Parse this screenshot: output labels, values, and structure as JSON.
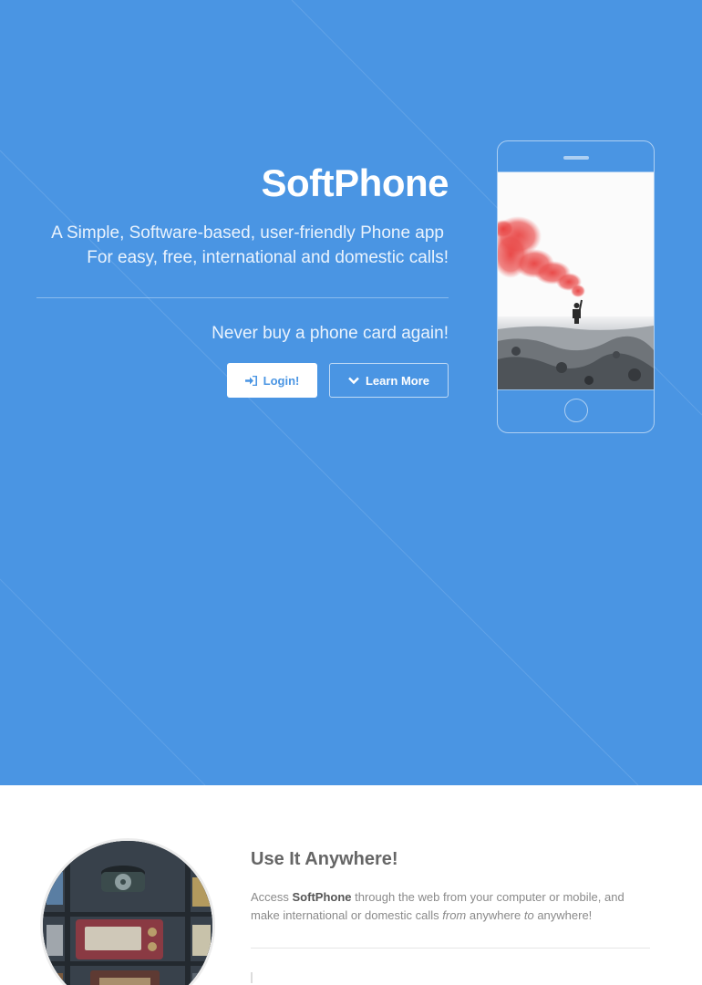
{
  "hero": {
    "title": "SoftPhone",
    "tagline_line1": "A Simple, Software-based, user-friendly Phone app",
    "tagline_line2": "For easy, free, international and domestic calls!",
    "subtitle": "Never buy a phone card again!",
    "login_label": "Login!",
    "learn_more_label": "Learn More",
    "login_icon": "sign-in-icon",
    "learn_more_icon": "chevron-down-icon"
  },
  "phone_mockup": {
    "screen_image": "person-holding-red-smoke-flare-on-rocky-shore"
  },
  "feature": {
    "title": "Use It Anywhere!",
    "desc_before": "Access ",
    "desc_brand": "SoftPhone",
    "desc_middle": " through the web from your computer or mobile, and make international or domestic calls ",
    "desc_from": "from",
    "desc_anywhere1": " anywhere ",
    "desc_to": "to",
    "desc_anywhere2": " anywhere!",
    "image": "vintage-rotary-phone-and-radio-shelf"
  },
  "colors": {
    "hero_background": "#4a95e3",
    "button_text": "#4a95e3",
    "smoke": "#e8403f"
  }
}
